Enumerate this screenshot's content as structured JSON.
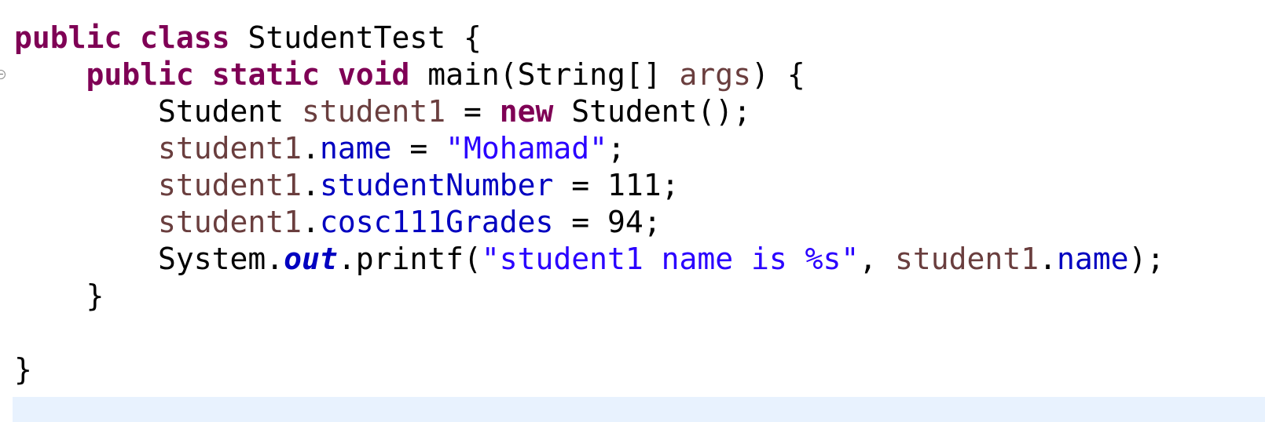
{
  "editor": {
    "lines": [
      {
        "tokens": [
          {
            "text": "public",
            "type": "keyword"
          },
          {
            "text": " ",
            "type": "plain"
          },
          {
            "text": "class",
            "type": "keyword"
          },
          {
            "text": " StudentTest {",
            "type": "plain"
          }
        ]
      },
      {
        "tokens": [
          {
            "text": "    ",
            "type": "plain"
          },
          {
            "text": "public",
            "type": "keyword"
          },
          {
            "text": " ",
            "type": "plain"
          },
          {
            "text": "static",
            "type": "keyword"
          },
          {
            "text": " ",
            "type": "plain"
          },
          {
            "text": "void",
            "type": "keyword"
          },
          {
            "text": " main(String[] ",
            "type": "plain"
          },
          {
            "text": "args",
            "type": "local"
          },
          {
            "text": ") {",
            "type": "plain"
          }
        ]
      },
      {
        "tokens": [
          {
            "text": "        Student ",
            "type": "plain"
          },
          {
            "text": "student1",
            "type": "local"
          },
          {
            "text": " = ",
            "type": "plain"
          },
          {
            "text": "new",
            "type": "keyword"
          },
          {
            "text": " Student();",
            "type": "plain"
          }
        ]
      },
      {
        "tokens": [
          {
            "text": "        ",
            "type": "plain"
          },
          {
            "text": "student1",
            "type": "local"
          },
          {
            "text": ".",
            "type": "plain"
          },
          {
            "text": "name",
            "type": "field"
          },
          {
            "text": " = ",
            "type": "plain"
          },
          {
            "text": "\"Mohamad\"",
            "type": "string"
          },
          {
            "text": ";",
            "type": "plain"
          }
        ]
      },
      {
        "tokens": [
          {
            "text": "        ",
            "type": "plain"
          },
          {
            "text": "student1",
            "type": "local"
          },
          {
            "text": ".",
            "type": "plain"
          },
          {
            "text": "studentNumber",
            "type": "field"
          },
          {
            "text": " = 111;",
            "type": "plain"
          }
        ]
      },
      {
        "tokens": [
          {
            "text": "        ",
            "type": "plain"
          },
          {
            "text": "student1",
            "type": "local"
          },
          {
            "text": ".",
            "type": "plain"
          },
          {
            "text": "cosc111Grades",
            "type": "field"
          },
          {
            "text": " = 94;",
            "type": "plain"
          }
        ]
      },
      {
        "tokens": [
          {
            "text": "        System.",
            "type": "plain"
          },
          {
            "text": "out",
            "type": "static-field"
          },
          {
            "text": ".printf(",
            "type": "plain"
          },
          {
            "text": "\"student1 name is %s\"",
            "type": "string"
          },
          {
            "text": ", ",
            "type": "plain"
          },
          {
            "text": "student1",
            "type": "local"
          },
          {
            "text": ".",
            "type": "plain"
          },
          {
            "text": "name",
            "type": "field"
          },
          {
            "text": ");",
            "type": "plain"
          }
        ]
      },
      {
        "tokens": [
          {
            "text": "    }",
            "type": "plain"
          }
        ]
      },
      {
        "tokens": [
          {
            "text": "",
            "type": "plain"
          }
        ]
      },
      {
        "tokens": [
          {
            "text": "}",
            "type": "plain"
          }
        ]
      }
    ],
    "token_colors": {
      "keyword": "#7f0055",
      "local": "#6a3e3e",
      "field": "#0000c0",
      "string": "#2a00ff",
      "static-field": "#0000c0",
      "plain": "#000000",
      "current_line_highlight": "#e8f2fe"
    },
    "icons": {
      "fold": "collapse-minus-icon"
    }
  }
}
